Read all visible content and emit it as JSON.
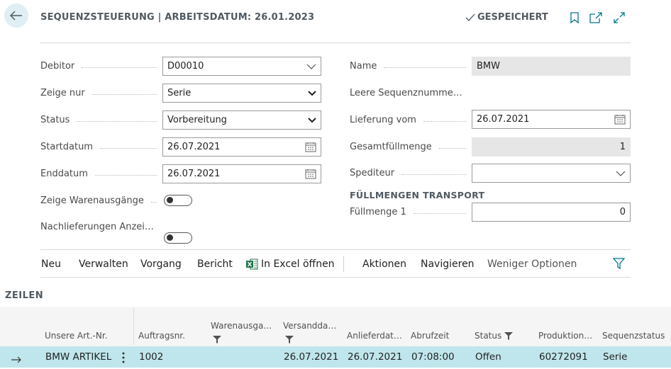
{
  "header": {
    "title": "SEQUENZSTEUERUNG | ARBEITSDATUM: 26.01.2023",
    "saved_label": "GESPEICHERT"
  },
  "form": {
    "left": [
      {
        "label": "Debitor",
        "value": "D00010",
        "type": "lookup"
      },
      {
        "label": "Zeige nur",
        "value": "Serie",
        "type": "select"
      },
      {
        "label": "Status",
        "value": "Vorbereitung",
        "type": "select"
      },
      {
        "label": "Startdatum",
        "value": "26.07.2021",
        "type": "date"
      },
      {
        "label": "Enddatum",
        "value": "26.07.2021",
        "type": "date"
      },
      {
        "label": "Zeige Warenausgänge",
        "value": false,
        "type": "toggle"
      },
      {
        "label": "Nachlieferungen Anzei…",
        "value": false,
        "type": "toggle"
      }
    ],
    "right": [
      {
        "label": "Name",
        "value": "BMW",
        "type": "readonly"
      },
      {
        "label": "Leere Sequenznumme…",
        "value": false,
        "type": "toggle"
      },
      {
        "label": "Lieferung vom",
        "value": "26.07.2021",
        "type": "date"
      },
      {
        "label": "Gesamtfüllmenge",
        "value": "1",
        "type": "readonly-number"
      },
      {
        "label": "Spediteur",
        "value": "",
        "type": "lookup"
      }
    ],
    "transport_section": "FÜLLMENGEN TRANSPORT",
    "transport": [
      {
        "label": "Füllmenge 1",
        "value": "0",
        "type": "number"
      }
    ]
  },
  "actions": {
    "neu": "Neu",
    "verwalten": "Verwalten",
    "vorgang": "Vorgang",
    "bericht": "Bericht",
    "excel": "In Excel öffnen",
    "aktionen": "Aktionen",
    "navigieren": "Navigieren",
    "weniger": "Weniger Optionen"
  },
  "lines": {
    "title": "ZEILEN",
    "columns": [
      {
        "label": "Unsere Art.-Nr.",
        "filter": false
      },
      {
        "label": "Auftragsnr.",
        "filter": false
      },
      {
        "label": "Warenausga…",
        "filter": true
      },
      {
        "label": "Versandda…",
        "filter": true
      },
      {
        "label": "Anlieferdat…",
        "filter": false
      },
      {
        "label": "Abrufzeit",
        "filter": false
      },
      {
        "label": "Status",
        "filter": true
      },
      {
        "label": "Produktion…",
        "filter": false
      },
      {
        "label": "Sequenzstatus",
        "filter": false
      }
    ],
    "rows": [
      {
        "art_nr": "BMW ARTIKEL",
        "auftragsnr": "1002",
        "warenausgang": "",
        "versanddatum": "26.07.2021",
        "anlieferdatum": "26.07.2021",
        "abrufzeit": "07:08:00",
        "status": "Offen",
        "produktion": "60272091",
        "sequenzstatus": "Serie"
      }
    ]
  },
  "colors": {
    "accent": "#00778b",
    "selected_row": "#bfe6ec",
    "back_button_bg": "#dfeff3",
    "excel_green": "#217346"
  }
}
